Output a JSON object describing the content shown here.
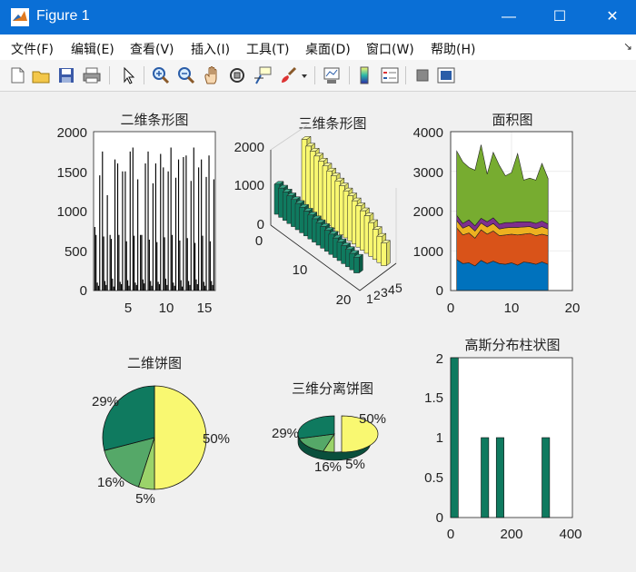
{
  "window": {
    "title": "Figure 1",
    "minimize": "—",
    "maximize": "☐",
    "close": "✕"
  },
  "menu": [
    "文件(F)",
    "编辑(E)",
    "查看(V)",
    "插入(I)",
    "工具(T)",
    "桌面(D)",
    "窗口(W)",
    "帮助(H)"
  ],
  "menu_pin": "↘",
  "toolbar": [
    "new-icon",
    "open-icon",
    "save-icon",
    "print-icon",
    "pointer-icon",
    "zoom-in-icon",
    "zoom-out-icon",
    "pan-icon",
    "rotate-3d-icon",
    "data-cursor-icon",
    "brush-icon",
    "link-plot-icon",
    "colorbar-icon",
    "legend-icon",
    "hide-plot-tools-icon",
    "show-plot-tools-icon"
  ],
  "colors": {
    "titlebar": "#0a6fd6",
    "bar_dark": "#000000",
    "parula_teal": "#0f7a5f",
    "parula_green": "#55a868",
    "parula_yellow": "#f9f871",
    "area_blue": "#0072bd",
    "area_orange": "#d95319",
    "area_yellow": "#edb120",
    "area_purple": "#7e2f8e",
    "area_green": "#77ac30"
  },
  "chart_data": [
    {
      "id": "bar2d",
      "type": "bar",
      "title": "二维条形图",
      "xlim": [
        0.5,
        16.5
      ],
      "ylim": [
        0,
        2000
      ],
      "xticks": [
        5,
        10,
        15
      ],
      "yticks": [
        0,
        500,
        1000,
        1500,
        2000
      ],
      "categories": [
        1,
        2,
        3,
        4,
        5,
        6,
        7,
        8,
        9,
        10,
        11,
        12,
        13,
        14,
        15,
        16
      ],
      "series": [
        {
          "values": [
            800,
            1750,
            700,
            1600,
            1500,
            1800,
            700,
            1750,
            1600,
            1550,
            1800,
            1650,
            1700,
            1800,
            1650,
            1700
          ]
        },
        {
          "values": [
            700,
            680,
            650,
            700,
            620,
            690,
            700,
            640,
            610,
            670,
            700,
            630,
            660,
            600,
            690,
            620
          ]
        },
        {
          "values": [
            100,
            120,
            150,
            110,
            130,
            100,
            140,
            120,
            110,
            150,
            100,
            130,
            120,
            140,
            110,
            120
          ]
        },
        {
          "values": [
            60,
            70,
            50,
            80,
            60,
            70,
            90,
            60,
            80,
            70,
            60,
            50,
            70,
            80,
            60,
            70
          ]
        },
        {
          "values": [
            1450,
            1200,
            1650,
            1500,
            1750,
            1400,
            1600,
            1350,
            1720,
            1500,
            1420,
            1680,
            1380,
            1550,
            1430,
            1400
          ]
        }
      ]
    },
    {
      "id": "bar3d",
      "type": "bar",
      "title": "三维条形图",
      "zlim": [
        0,
        2000
      ],
      "zticks": [
        "0",
        "1000",
        "2000"
      ],
      "rows_ticks": [
        "0",
        "10",
        "20"
      ],
      "cols_ticks": [
        "1",
        "2",
        "3",
        "4",
        "5"
      ],
      "front": [
        800,
        780,
        760,
        740,
        720,
        700,
        680,
        660,
        640,
        620,
        600,
        580,
        560,
        540,
        520,
        500,
        480,
        460,
        440,
        420
      ],
      "back": [
        1800,
        1700,
        1650,
        1600,
        1550,
        1500,
        1450,
        1400,
        1350,
        1300,
        1250,
        1200,
        1150,
        1100,
        1050,
        1000,
        900,
        800,
        700,
        600
      ]
    },
    {
      "id": "area",
      "type": "area",
      "title": "面积图",
      "xlim": [
        0,
        20
      ],
      "ylim": [
        0,
        4000
      ],
      "xticks": [
        0,
        10,
        20
      ],
      "yticks": [
        0,
        1000,
        2000,
        3000,
        4000
      ],
      "x": [
        1,
        2,
        3,
        4,
        5,
        6,
        7,
        8,
        9,
        10,
        11,
        12,
        13,
        14,
        15,
        16
      ],
      "series": [
        {
          "values": [
            780,
            680,
            700,
            620,
            760,
            680,
            740,
            680,
            660,
            700,
            640,
            720,
            700,
            660,
            720,
            660
          ]
        },
        {
          "values": [
            800,
            720,
            750,
            700,
            770,
            740,
            760,
            700,
            740,
            720,
            760,
            700,
            740,
            720,
            700,
            720
          ]
        },
        {
          "values": [
            180,
            170,
            190,
            180,
            170,
            180,
            190,
            170,
            180,
            170,
            190,
            180,
            170,
            180,
            190,
            170
          ]
        },
        {
          "values": [
            130,
            120,
            140,
            130,
            120,
            130,
            140,
            120,
            130,
            120,
            140,
            130,
            120,
            130,
            140,
            120
          ]
        },
        {
          "values": [
            1620,
            1550,
            1320,
            1400,
            1850,
            1200,
            1650,
            1480,
            1180,
            1260,
            1720,
            1050,
            1100,
            1090,
            1450,
            1150
          ]
        }
      ]
    },
    {
      "id": "pie2d",
      "type": "pie",
      "title": "二维饼图",
      "values": [
        50,
        5,
        16,
        29
      ],
      "labels": [
        "50%",
        "5%",
        "16%",
        "29%"
      ]
    },
    {
      "id": "pie3d",
      "type": "pie",
      "title": "三维分离饼图",
      "values": [
        50,
        5,
        16,
        29
      ],
      "labels": [
        "50%",
        "5%",
        "16%",
        "29%"
      ],
      "explode": [
        1,
        0,
        0,
        0
      ]
    },
    {
      "id": "hist",
      "type": "bar",
      "title": "高斯分布柱状图",
      "xlim": [
        0,
        400
      ],
      "ylim": [
        0,
        2
      ],
      "xticks": [
        0,
        200,
        400
      ],
      "yticks": [
        "0",
        "0.5",
        "1",
        "1.5",
        "2"
      ],
      "bins": [
        {
          "x0": 0,
          "x1": 25,
          "value": 2
        },
        {
          "x0": 75,
          "x1": 100,
          "value": 0
        },
        {
          "x0": 100,
          "x1": 125,
          "value": 1
        },
        {
          "x0": 150,
          "x1": 175,
          "value": 1
        },
        {
          "x0": 300,
          "x1": 325,
          "value": 1
        }
      ]
    }
  ]
}
